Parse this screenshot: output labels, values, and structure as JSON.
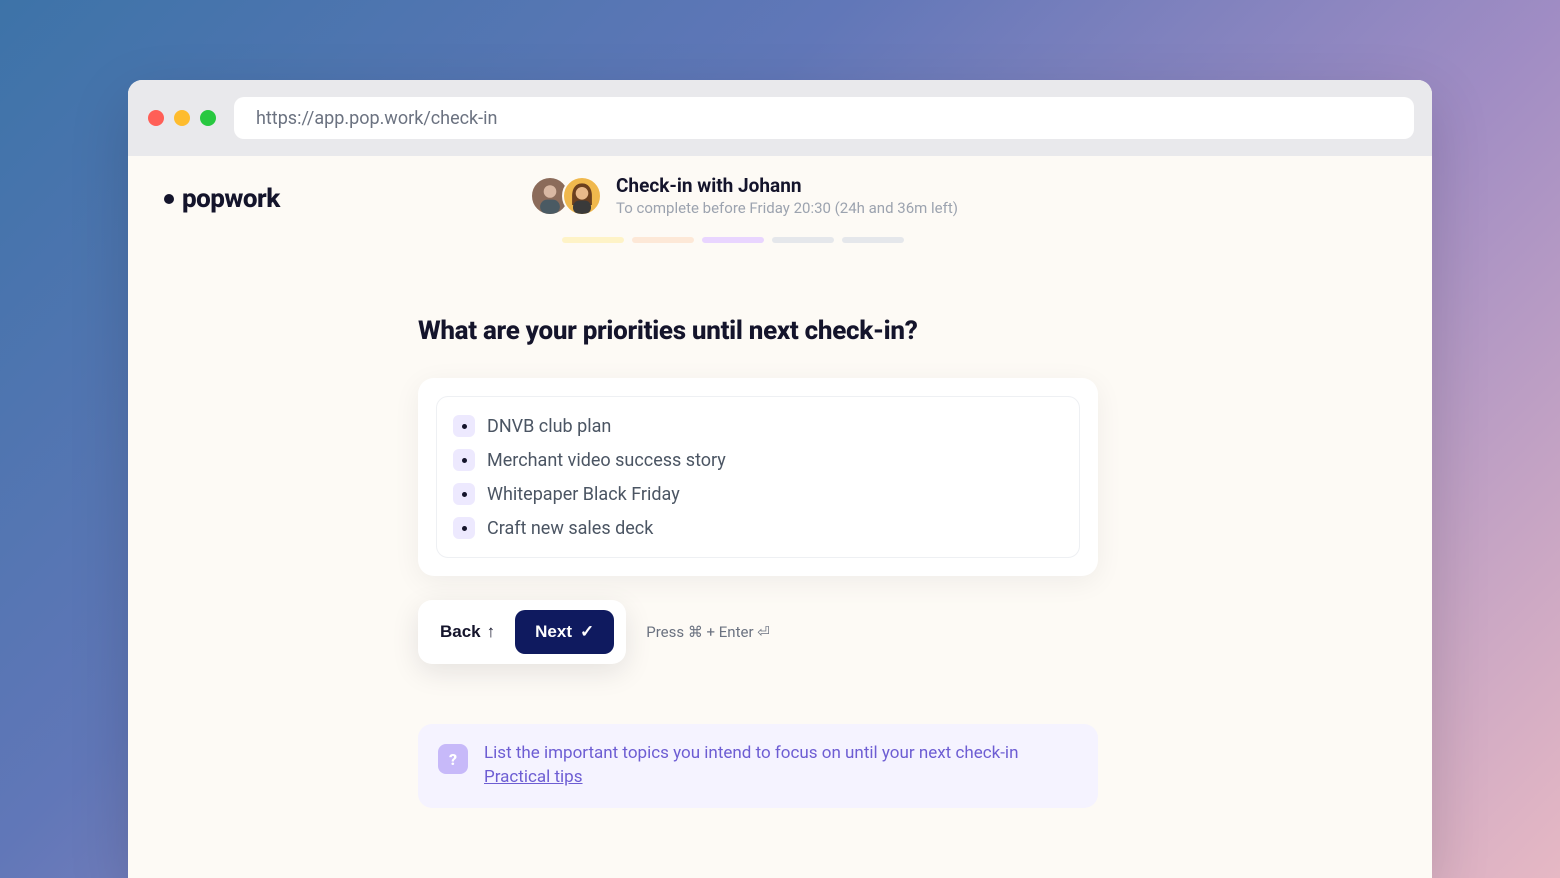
{
  "browser": {
    "url": "https://app.pop.work/check-in"
  },
  "brand": {
    "name": "popwork"
  },
  "header": {
    "title": "Check-in with Johann",
    "subtitle": "To complete before Friday 20:30 (24h and 36m left)"
  },
  "progress": {
    "total": 5,
    "current": 3,
    "colors": [
      "yellow",
      "orange",
      "purple",
      "grey",
      "grey"
    ]
  },
  "question": "What are your priorities until next check-in?",
  "priorities": [
    "DNVB club plan",
    "Merchant video success story",
    "Whitepaper Black Friday",
    "Craft new sales deck"
  ],
  "nav": {
    "back": "Back",
    "next": "Next",
    "shortcut_prefix": "Press ",
    "shortcut_keys": "⌘ + Enter ⏎"
  },
  "tip": {
    "text": "List the important topics you intend to focus on until your next check-in",
    "link": "Practical tips"
  }
}
